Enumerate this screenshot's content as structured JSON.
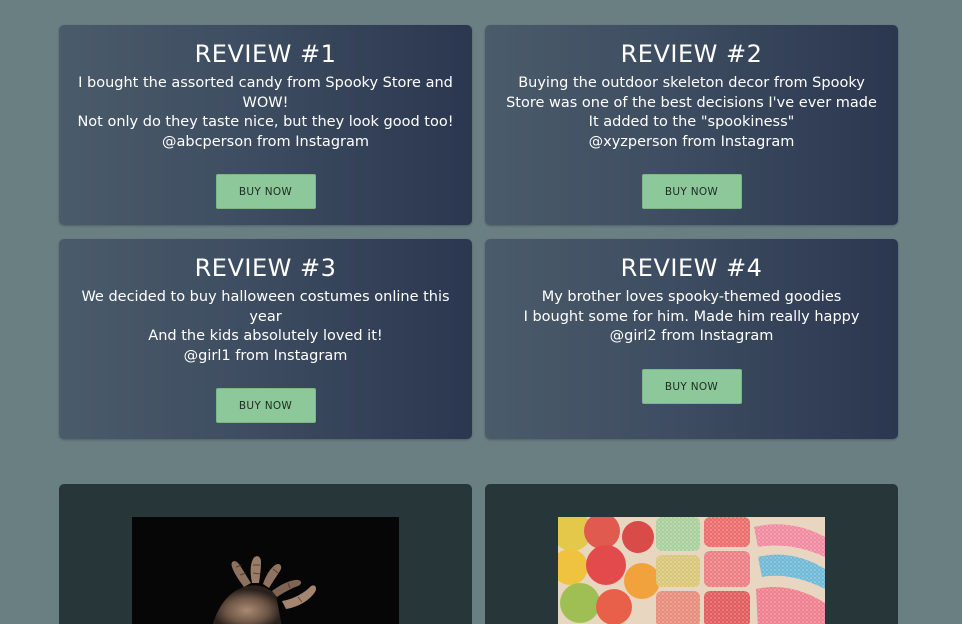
{
  "reviews": [
    {
      "title": "REVIEW #1",
      "lines": [
        "I bought the assorted candy from Spooky Store and WOW!",
        "Not only do they taste nice, but they look good too!",
        "@abcperson from Instagram"
      ],
      "button_label": "BUY NOW"
    },
    {
      "title": "REVIEW #2",
      "lines": [
        "Buying the outdoor skeleton decor from Spooky Store was one of the best decisions I've ever made",
        "It added to the \"spookiness\"",
        "@xyzperson from Instagram"
      ],
      "button_label": "BUY NOW"
    },
    {
      "title": "REVIEW #3",
      "lines": [
        "We decided to buy halloween costumes online this year",
        "And the kids absolutely loved it!",
        "@girl1 from Instagram"
      ],
      "button_label": "BUY NOW"
    },
    {
      "title": "REVIEW #4",
      "lines": [
        "My brother loves spooky-themed goodies",
        "I bought some for him. Made him really happy",
        "@girl2 from Instagram"
      ],
      "button_label": "BUY NOW"
    }
  ],
  "colors": {
    "page_background": "#6a7f82",
    "card_gradient_start": "#4a5b6a",
    "card_gradient_end": "#2b3750",
    "button_background": "#8dc89b",
    "image_card_background": "#263639"
  },
  "product_images": [
    {
      "icon": "skeleton-hand-photo"
    },
    {
      "icon": "sour-gummy-candy-photo"
    }
  ]
}
